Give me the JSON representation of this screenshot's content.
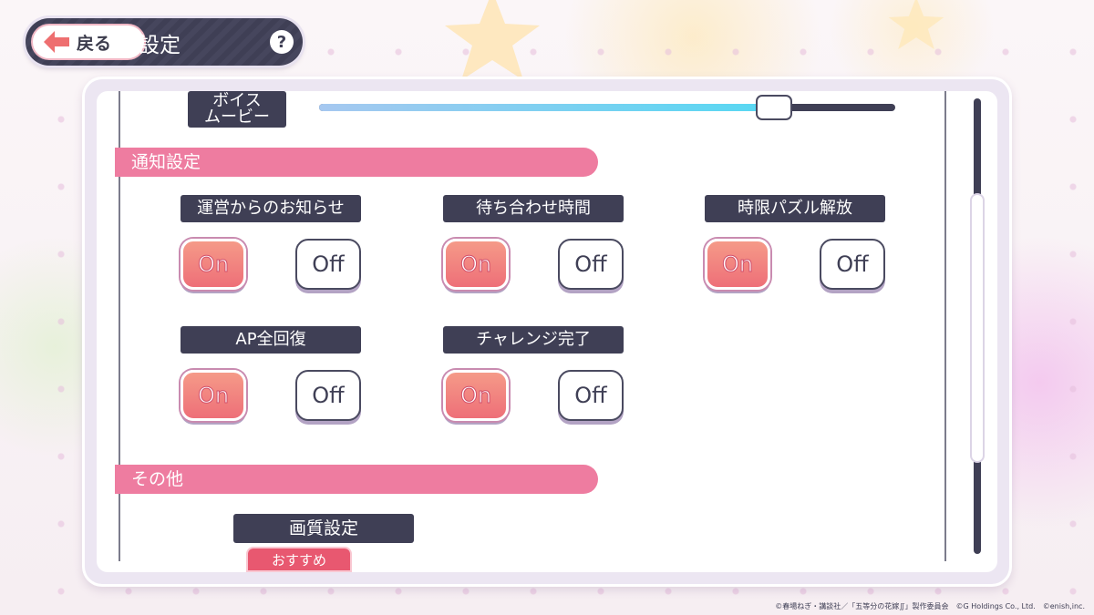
{
  "header": {
    "back_label": "戻る",
    "title": "設定",
    "help_label": "?"
  },
  "voice_movie": {
    "label": "ボイス\nムービー",
    "volume_fraction": 0.79
  },
  "sections": {
    "notification": {
      "title": "通知設定",
      "items": [
        {
          "label": "運営からのお知らせ",
          "on": "On",
          "off": "Off",
          "selected": "on"
        },
        {
          "label": "待ち合わせ時間",
          "on": "On",
          "off": "Off",
          "selected": "on"
        },
        {
          "label": "時限パズル解放",
          "on": "On",
          "off": "Off",
          "selected": "on"
        },
        {
          "label": "AP全回復",
          "on": "On",
          "off": "Off",
          "selected": "on"
        },
        {
          "label": "チャレンジ完了",
          "on": "On",
          "off": "Off",
          "selected": "on"
        }
      ]
    },
    "other": {
      "title": "その他",
      "quality_label": "画質設定",
      "recommend_badge": "おすすめ"
    }
  },
  "copyright": "©春場ねぎ・講談社／「五等分の花嫁∬」製作委員会　©G Holdings Co., Ltd.　©enish,inc.",
  "colors": {
    "section_header": "#ee7ca0",
    "label_bg": "#3f3f55",
    "on_button": "#ee6f78",
    "slider_fill": "#56d8f2"
  }
}
